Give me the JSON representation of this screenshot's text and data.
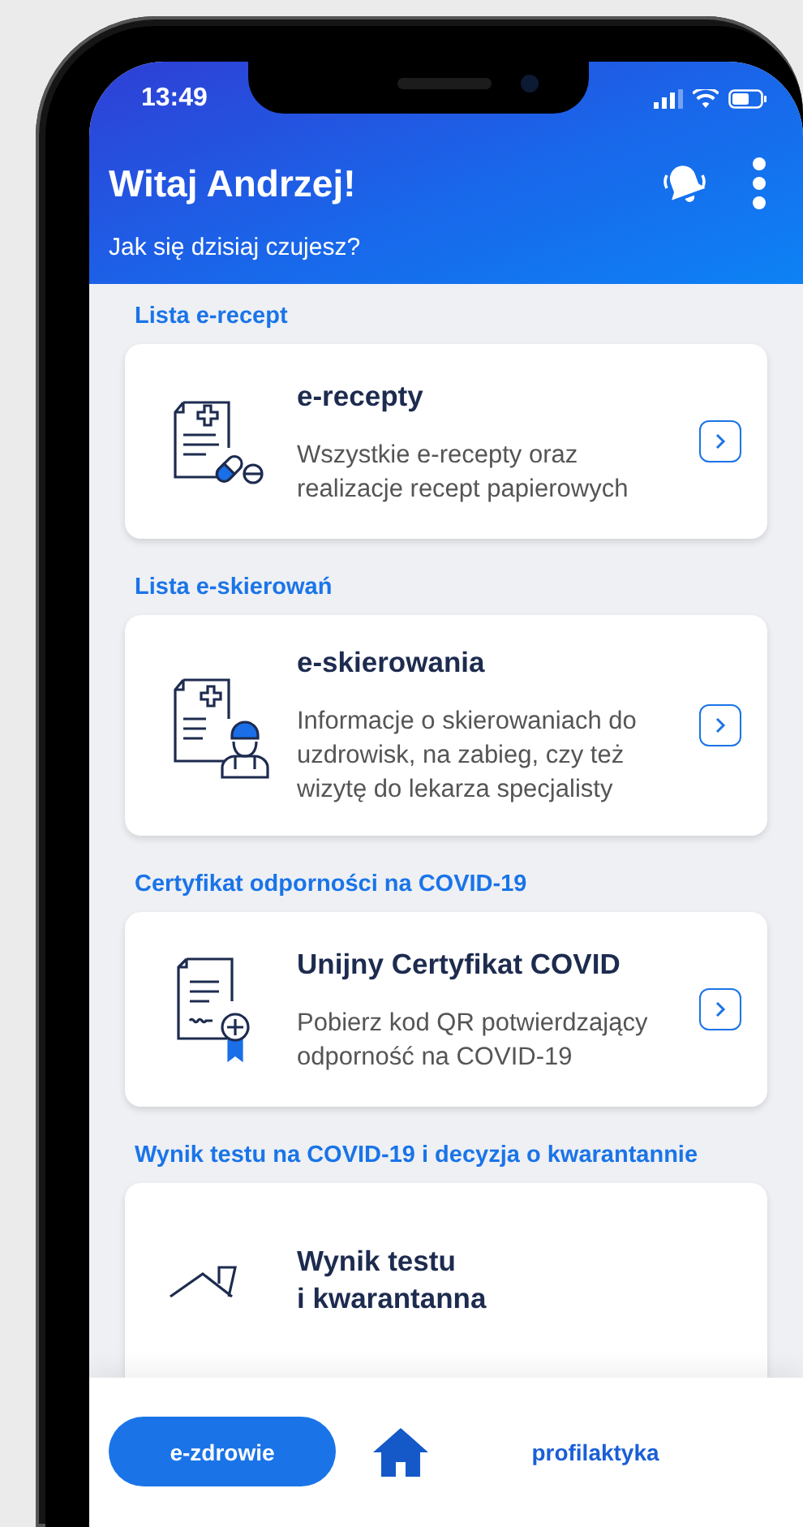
{
  "status_bar": {
    "time": "13:49"
  },
  "header": {
    "title": "Witaj Andrzej!",
    "subtitle": "Jak się dzisiaj czujesz?"
  },
  "sections": [
    {
      "heading": "Lista e-recept",
      "card": {
        "title": "e-recepty",
        "description": "Wszystkie e-recepty oraz realizacje recept papierowych",
        "chevron": true
      }
    },
    {
      "heading": "Lista e-skierowań",
      "card": {
        "title": "e-skierowania",
        "description": "Informacje o skierowaniach do uzdrowisk, na zabieg, czy też wizytę do lekarza specjalisty",
        "chevron": true
      }
    },
    {
      "heading": "Certyfikat odporności na COVID-19",
      "card": {
        "title": "Unijny Certyfikat COVID",
        "description": "Pobierz kod QR potwierdzający odporność na COVID-19",
        "chevron": true
      }
    },
    {
      "heading": "Wynik testu na COVID-19 i decyzja o kwarantannie",
      "card": {
        "title": "Wynik testu\ni kwarantanna",
        "chevron": false
      }
    }
  ],
  "bottom_nav": {
    "items": [
      {
        "kind": "text",
        "label": "e-zdrowie",
        "selected": true
      },
      {
        "kind": "home",
        "selected": false
      },
      {
        "kind": "text",
        "label": "profilaktyka",
        "selected": false
      }
    ]
  }
}
